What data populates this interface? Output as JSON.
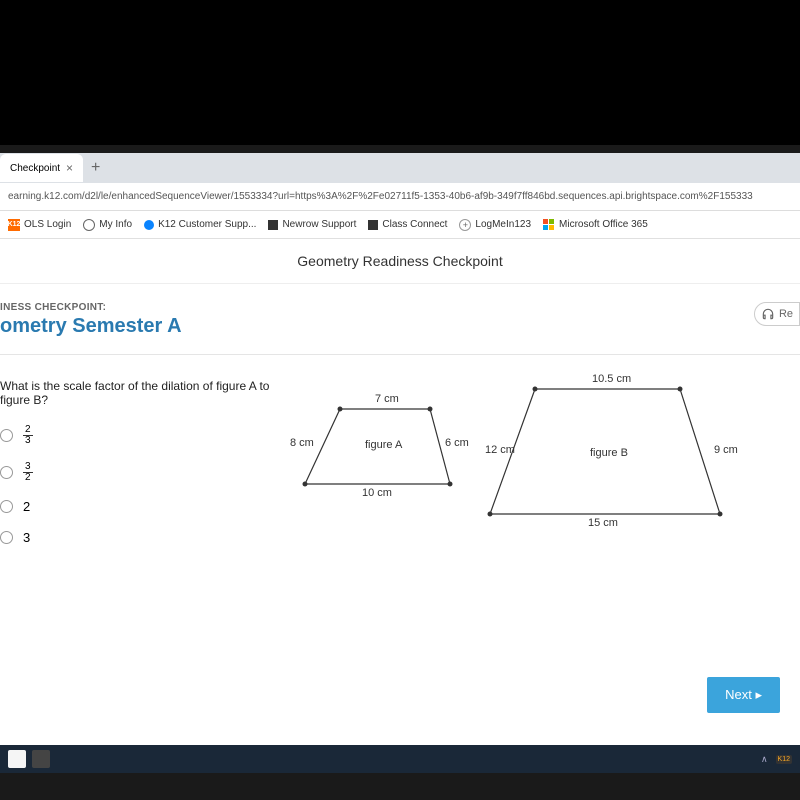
{
  "tab": {
    "title": "Checkpoint",
    "close": "×",
    "plus": "+"
  },
  "url": "earning.k12.com/d2l/le/enhancedSequenceViewer/1553334?url=https%3A%2F%2Fe02711f5-1353-40b6-af9b-349f7ff846bd.sequences.api.brightspace.com%2F155333",
  "bookmarks": {
    "ols": "OLS Login",
    "k12label": "K12",
    "myinfo": "My Info",
    "support": "K12 Customer Supp...",
    "newrow": "Newrow Support",
    "classconnect": "Class Connect",
    "logmein": "LogMeIn123",
    "office": "Microsoft Office 365"
  },
  "page_title": "Geometry Readiness Checkpoint",
  "checkpoint_label": "INESS CHECKPOINT:",
  "semester": "ometry Semester A",
  "read_label": "Re",
  "question": "What is the scale factor of the dilation of figure A to figure B?",
  "options": {
    "a_num": "2",
    "a_den": "3",
    "b_num": "3",
    "b_den": "2",
    "c": "2",
    "d": "3"
  },
  "figure_a": {
    "label": "figure A",
    "top": "7 cm",
    "left": "8 cm",
    "right": "6 cm",
    "bottom": "10 cm"
  },
  "figure_b": {
    "label": "figure B",
    "top": "10.5 cm",
    "left": "12 cm",
    "right": "9 cm",
    "bottom": "15 cm"
  },
  "next": "Next ▸",
  "taskbar_caret": "∧",
  "taskbar_k12": "K12"
}
